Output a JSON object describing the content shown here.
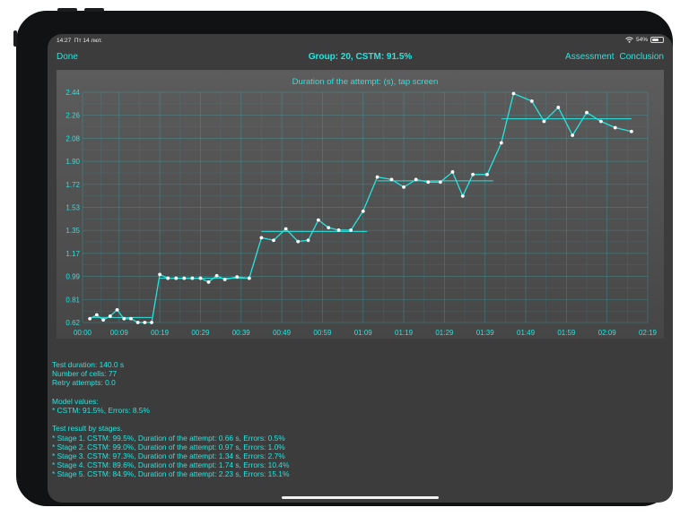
{
  "status_bar": {
    "time": "14:27",
    "date": "Пт 14 лют.",
    "battery": "54%",
    "battery_level": 0.54
  },
  "nav": {
    "done_label": "Done",
    "title": "Group: 20, CSTM: 91.5%",
    "assessment_label": "Assessment",
    "conclusion_label": "Conclusion"
  },
  "chart_data": {
    "type": "line",
    "title": "Duration of the attempt: (s), tap screen",
    "xlabel": "Time",
    "ylabel": "",
    "x_unit": "seconds",
    "xlim": [
      0,
      139
    ],
    "ylim": [
      0.62,
      2.44
    ],
    "x_ticks": [
      {
        "value": 0,
        "label": "00:00"
      },
      {
        "value": 9,
        "label": "00:09"
      },
      {
        "value": 19,
        "label": "00:19"
      },
      {
        "value": 29,
        "label": "00:29"
      },
      {
        "value": 39,
        "label": "00:39"
      },
      {
        "value": 49,
        "label": "00:49"
      },
      {
        "value": 59,
        "label": "00:59"
      },
      {
        "value": 69,
        "label": "01:09"
      },
      {
        "value": 79,
        "label": "01:19"
      },
      {
        "value": 89,
        "label": "01:29"
      },
      {
        "value": 99,
        "label": "01:39"
      },
      {
        "value": 109,
        "label": "01:49"
      },
      {
        "value": 119,
        "label": "01:59"
      },
      {
        "value": 129,
        "label": "02:09"
      },
      {
        "value": 139,
        "label": "02:19"
      }
    ],
    "y_ticks": [
      "0.62",
      "0.81",
      "0.99",
      "1.17",
      "1.35",
      "1.53",
      "1.72",
      "1.90",
      "2.08",
      "2.26",
      "2.44"
    ],
    "grid": true,
    "color": "#25e5df",
    "series": [
      {
        "points": [
          [
            1.8,
            0.65
          ],
          [
            3.5,
            0.68
          ],
          [
            5.1,
            0.64
          ],
          [
            6.8,
            0.67
          ],
          [
            8.5,
            0.72
          ],
          [
            10.2,
            0.65
          ],
          [
            11.9,
            0.65
          ],
          [
            13.6,
            0.62
          ],
          [
            15.3,
            0.62
          ],
          [
            17.0,
            0.62
          ],
          [
            19.0,
            1.0
          ],
          [
            21.0,
            0.97
          ],
          [
            23.0,
            0.97
          ],
          [
            25.0,
            0.97
          ],
          [
            27.0,
            0.97
          ],
          [
            29.0,
            0.97
          ],
          [
            31.0,
            0.94
          ],
          [
            33.0,
            0.99
          ],
          [
            35.0,
            0.96
          ],
          [
            38.0,
            0.98
          ],
          [
            41.0,
            0.97
          ],
          [
            44.0,
            1.29
          ],
          [
            47.0,
            1.27
          ],
          [
            50.0,
            1.36
          ],
          [
            53.0,
            1.26
          ],
          [
            55.5,
            1.27
          ],
          [
            58.0,
            1.43
          ],
          [
            60.5,
            1.37
          ],
          [
            63.0,
            1.35
          ],
          [
            66.0,
            1.35
          ],
          [
            69.0,
            1.5
          ],
          [
            72.5,
            1.77
          ],
          [
            76.0,
            1.75
          ],
          [
            79.0,
            1.69
          ],
          [
            82.0,
            1.75
          ],
          [
            85.0,
            1.73
          ],
          [
            88.0,
            1.73
          ],
          [
            91.0,
            1.81
          ],
          [
            93.5,
            1.62
          ],
          [
            96.0,
            1.79
          ],
          [
            99.5,
            1.79
          ],
          [
            103.0,
            2.04
          ],
          [
            106.0,
            2.43
          ],
          [
            110.5,
            2.37
          ],
          [
            113.5,
            2.21
          ],
          [
            117.0,
            2.32
          ],
          [
            120.5,
            2.1
          ],
          [
            124.0,
            2.28
          ],
          [
            127.5,
            2.21
          ],
          [
            131.0,
            2.16
          ],
          [
            135.0,
            2.13
          ]
        ]
      }
    ],
    "stage_averages": [
      {
        "x_start": 1.8,
        "x_end": 17,
        "value": 0.66
      },
      {
        "x_start": 19,
        "x_end": 41,
        "value": 0.97
      },
      {
        "x_start": 44,
        "x_end": 70,
        "value": 1.34
      },
      {
        "x_start": 72.5,
        "x_end": 101,
        "value": 1.74
      },
      {
        "x_start": 103,
        "x_end": 135,
        "value": 2.23
      }
    ]
  },
  "info": {
    "test_duration": "Test duration: 140.0 s",
    "number_of_cells": "Number of cells: 77",
    "retry_attempts": "Retry attempts: 0.0",
    "model_values_heading": "Model values:",
    "model_values": "* CSTM: 91.5%, Errors: 8.5%",
    "stages_heading": "Test result by stages.",
    "stages": [
      "* Stage 1. CSTM: 99.5%, Duration of the attempt: 0.66 s, Errors: 0.5%",
      "* Stage 2. CSTM: 99.0%, Duration of the attempt: 0.97 s, Errors: 1.0%",
      "* Stage 3. CSTM: 97.3%, Duration of the attempt: 1.34 s, Errors: 2.7%",
      "* Stage 4. CSTM: 89.6%, Duration of the attempt: 1.74 s, Errors: 10.4%",
      "* Stage 5. CSTM: 84.9%, Duration of the attempt: 2.23 s, Errors: 15.1%"
    ]
  }
}
